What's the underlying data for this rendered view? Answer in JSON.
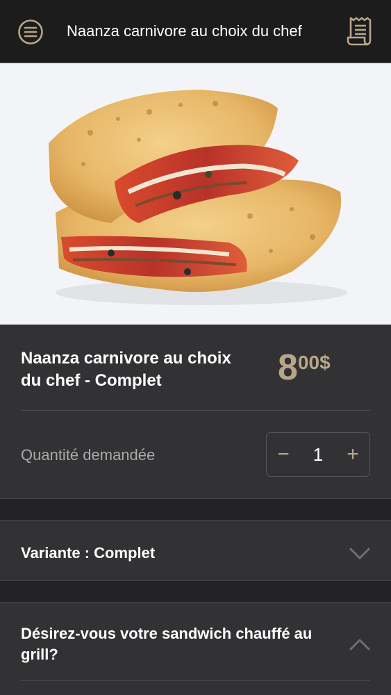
{
  "header": {
    "title": "Naanza carnivore au choix du chef",
    "menu_icon": "hamburger-circle-icon",
    "receipt_icon": "receipt-icon",
    "accent_color": "#b7a689"
  },
  "hero": {
    "image_subject": "pizza-sandwich-photo"
  },
  "product": {
    "name": "Naanza carnivore au choix du chef - Complet",
    "price_integer": "8",
    "price_decimal": "00$",
    "quantity_label": "Quantité demandée",
    "quantity_value": "1",
    "minus_label": "−",
    "plus_label": "+"
  },
  "options": [
    {
      "label": "Variante : Complet",
      "state": "collapsed",
      "chevron_icon": "chevron-down-icon"
    },
    {
      "label": "Désirez-vous votre sandwich chauffé au grill?",
      "state": "expanded",
      "chevron_icon": "chevron-up-icon"
    }
  ]
}
